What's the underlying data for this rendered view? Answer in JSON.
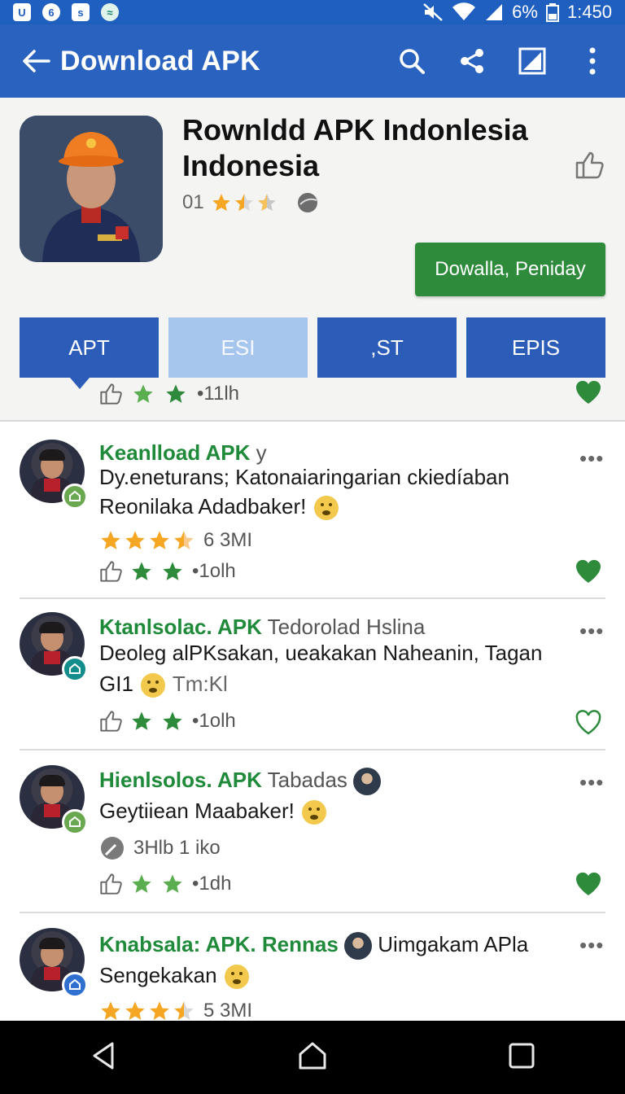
{
  "status_bar": {
    "battery": "6%",
    "time": "1:450",
    "icons": [
      "app-icon-u",
      "app-icon-6",
      "app-icon-s",
      "app-icon-g",
      "mute-icon",
      "wifi-icon",
      "signal-icon",
      "battery-icon"
    ]
  },
  "app_bar": {
    "title": "Download APK",
    "actions": [
      "search-icon",
      "share-icon",
      "edit-icon",
      "more-vert-icon"
    ]
  },
  "header": {
    "app_name": "Rownldd APK Indonlesia Indonesia",
    "rating_number": "01",
    "download_button": "Dowalla, Peniday",
    "tabs": [
      {
        "label": "APT",
        "active": true
      },
      {
        "label": "ESI",
        "active": false
      },
      {
        "label": ",ST",
        "active": false
      },
      {
        "label": "EPIS",
        "active": false
      }
    ],
    "meta": "•11lh"
  },
  "posts": [
    {
      "title_highlight": "Keanlload APK",
      "title_rest": "y",
      "line1": "Dy.eneturans; Katonaiaringarian ckiedíaban",
      "line2": "Reonilaka Adadbaker!",
      "rating_text": "6 3MI",
      "stars": 3.5,
      "meta": "•1olh",
      "badge_color": "#6aa84f",
      "liked": true
    },
    {
      "title_highlight": "Ktanlsolac. APK",
      "title_rest": "Tedorolad Hslina",
      "line1": "Deoleg alPKsakan, ueakakan Naheanin, Tagan",
      "line2_a": "GI1",
      "line2_b": "Tm:Kl",
      "meta": "•1olh",
      "badge_color": "#138c8c",
      "liked": false
    },
    {
      "title_highlight": "Hienlsolos. APK",
      "title_rest": "Tabadas",
      "line1": "Geytiiean Maabaker!",
      "info": "3Hlb 1 iko",
      "meta": "•1dh",
      "badge_color": "#6aa84f",
      "liked": true
    },
    {
      "title_highlight": "Knabsala: APK. Rennas",
      "title_rest": "Uimgakam APla",
      "line1": "Sengekakan",
      "rating_text": "5 3MI",
      "stars": 3.5,
      "badge_color": "#2e6fd0"
    }
  ],
  "colors": {
    "primary": "#2a62c0",
    "accent_green": "#2e8b3c",
    "title_green": "#1f8a3a",
    "star": "#f5a623"
  },
  "nav": [
    "back-icon",
    "home-icon",
    "recents-icon"
  ]
}
